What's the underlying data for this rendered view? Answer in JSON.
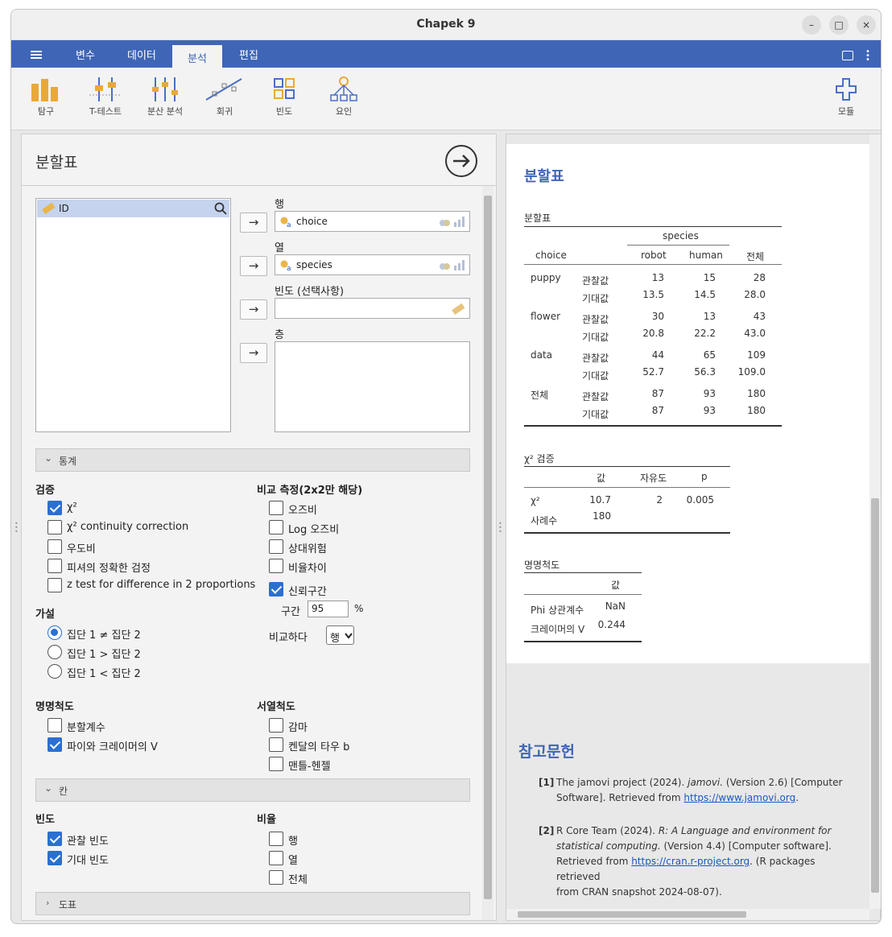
{
  "window": {
    "title": "Chapek 9",
    "controls": [
      "–",
      "□",
      "×"
    ]
  },
  "menu": {
    "tabs": [
      "변수",
      "데이터",
      "분석",
      "편집"
    ]
  },
  "toolbar": {
    "tools": [
      "탐구",
      "T-테스트",
      "분산 분석",
      "회귀",
      "빈도",
      "요인"
    ],
    "modules": "모듈"
  },
  "analysis": {
    "title": "분할표",
    "var_list": [
      "ID"
    ],
    "targets": {
      "rows_label": "행",
      "rows_var": "choice",
      "cols_label": "열",
      "cols_var": "species",
      "counts_label": "빈도 (선택사항)",
      "layers_label": "층"
    },
    "sections": {
      "stats": "통계",
      "cells": "칸",
      "plots": "도표"
    },
    "tests": {
      "header": "검증",
      "items": [
        {
          "label": "χ²",
          "checked": true
        },
        {
          "label": "χ² continuity correction",
          "checked": false
        },
        {
          "label": "우도비",
          "checked": false
        },
        {
          "label": "피셔의 정확한 검정",
          "checked": false
        },
        {
          "label": "z test for difference in 2 proportions",
          "checked": false
        }
      ]
    },
    "comparative": {
      "header": "비교 측정(2x2만 해당)",
      "items": [
        {
          "label": "오즈비",
          "checked": false
        },
        {
          "label": "Log 오즈비",
          "checked": false
        },
        {
          "label": "상대위험",
          "checked": false
        },
        {
          "label": "비율차이",
          "checked": false
        },
        {
          "label": "신뢰구간",
          "checked": true
        }
      ],
      "interval_label": "구간",
      "interval_value": "95",
      "percent": "%",
      "compare_label": "비교하다",
      "compare_value": "행"
    },
    "hypothesis": {
      "header": "가설",
      "items": [
        {
          "label": "집단 1 ≠ 집단 2",
          "checked": true
        },
        {
          "label": "집단 1 > 집단 2",
          "checked": false
        },
        {
          "label": "집단 1 < 집단 2",
          "checked": false
        }
      ]
    },
    "nominal": {
      "header": "명명척도",
      "items": [
        {
          "label": "분할계수",
          "checked": false
        },
        {
          "label": "파이와 크레이머의 V",
          "checked": true
        }
      ]
    },
    "ordinal": {
      "header": "서열척도",
      "items": [
        {
          "label": "감마",
          "checked": false
        },
        {
          "label": "켄달의 타우 b",
          "checked": false
        },
        {
          "label": "맨틀-헨젤",
          "checked": false
        }
      ]
    },
    "counts": {
      "header": "빈도",
      "items": [
        {
          "label": "관찰 빈도",
          "checked": true
        },
        {
          "label": "기대 빈도",
          "checked": true
        }
      ]
    },
    "percentages": {
      "header": "비율",
      "items": [
        {
          "label": "행",
          "checked": false
        },
        {
          "label": "열",
          "checked": false
        },
        {
          "label": "전체",
          "checked": false
        }
      ]
    }
  },
  "results": {
    "title": "분할표",
    "ct": {
      "caption": "분할표",
      "group_header": "species",
      "row_header": "choice",
      "col_headers": [
        "robot",
        "human",
        "전체"
      ],
      "rows": [
        {
          "name": "puppy",
          "obs_label": "관찰값",
          "exp_label": "기대값",
          "obs": [
            "13",
            "15",
            "28"
          ],
          "exp": [
            "13.5",
            "14.5",
            "28.0"
          ]
        },
        {
          "name": "flower",
          "obs_label": "관찰값",
          "exp_label": "기대값",
          "obs": [
            "30",
            "13",
            "43"
          ],
          "exp": [
            "20.8",
            "22.2",
            "43.0"
          ]
        },
        {
          "name": "data",
          "obs_label": "관찰값",
          "exp_label": "기대값",
          "obs": [
            "44",
            "65",
            "109"
          ],
          "exp": [
            "52.7",
            "56.3",
            "109.0"
          ]
        },
        {
          "name": "전체",
          "obs_label": "관찰값",
          "exp_label": "기대값",
          "obs": [
            "87",
            "93",
            "180"
          ],
          "exp": [
            "87",
            "93",
            "180"
          ]
        }
      ]
    },
    "chisq": {
      "caption": "χ² 검증",
      "col_headers": [
        "값",
        "자유도",
        "p"
      ],
      "row1": {
        "label": "χ²",
        "value": "10.7",
        "df": "2",
        "p": "0.005"
      },
      "row2": {
        "label": "사례수",
        "value": "180"
      }
    },
    "nominal": {
      "caption": "명명척도",
      "col_header": "값",
      "row1": {
        "label": "Phi 상관계수",
        "value": "NaN"
      },
      "row2": {
        "label": "크레이머의 V",
        "value": "0.244"
      }
    },
    "refs": {
      "title": "참고문헌",
      "r1": {
        "num": "[1]",
        "a": "The jamovi project (2024). ",
        "b": "jamovi.",
        "c": " (Version 2.6) [Computer",
        "d": "Software]. Retrieved from ",
        "link": "https://www.jamovi.org",
        "e": "."
      },
      "r2": {
        "num": "[2]",
        "a": "R Core Team (2024). ",
        "b": "R: A Language and environment for",
        "b2": "statistical computing.",
        "c": " (Version 4.4) [Computer software].",
        "d": "Retrieved from ",
        "link": "https://cran.r-project.org",
        "e": ". (R packages retrieved",
        "f": "from CRAN snapshot 2024-08-07)."
      }
    }
  }
}
